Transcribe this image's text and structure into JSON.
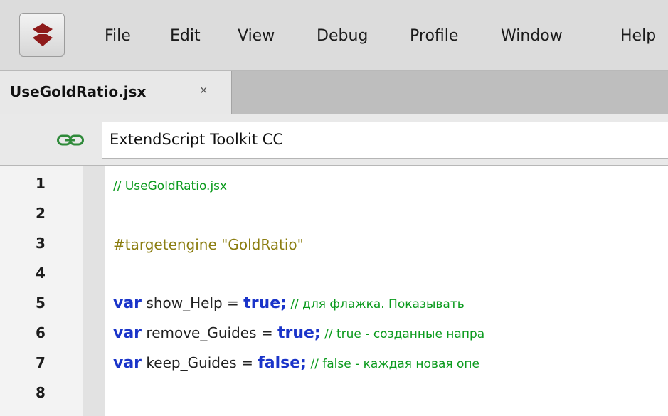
{
  "menubar": {
    "items": [
      "File",
      "Edit",
      "View",
      "Debug",
      "Profile",
      "Window",
      "Help"
    ]
  },
  "tabs": [
    {
      "label": "UseGoldRatio.jsx",
      "close": "×"
    }
  ],
  "target": {
    "app": "ExtendScript Toolkit CC"
  },
  "editor": {
    "line_numbers": [
      "1",
      "2",
      "3",
      "4",
      "5",
      "6",
      "7",
      "8"
    ],
    "lines": {
      "l1": {
        "comment": "// UseGoldRatio.jsx"
      },
      "l3": {
        "directive": "#targetengine \"GoldRatio\""
      },
      "l5": {
        "kw": "var",
        "name": " show_Help = ",
        "val": "true;",
        "comment": " // для флажка. Показывать "
      },
      "l6": {
        "kw": "var",
        "name": " remove_Guides = ",
        "val": "true;",
        "comment": " // true - созданные напра"
      },
      "l7": {
        "kw": "var",
        "name": " keep_Guides = ",
        "val": "false;",
        "comment": " // false - каждая новая опе"
      }
    }
  },
  "colors": {
    "keyword": "#1a34c9",
    "comment": "#0a9a1c",
    "directive": "#8b7d10"
  }
}
